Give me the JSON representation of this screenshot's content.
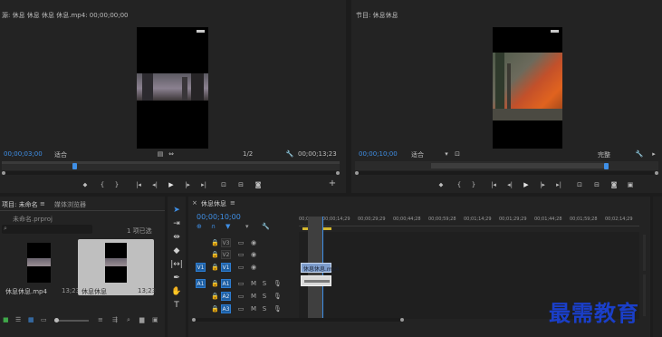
{
  "source_monitor": {
    "title": "源: 休息 休息 休息 休息.mp4: 00;00;00;00",
    "menu_glyph": "≡",
    "timecode": "00;00;03;00",
    "fit_label": "适合",
    "page_fraction": "1/2",
    "duration": "00;00;13;23",
    "plus": "+"
  },
  "program_monitor": {
    "title": "节目: 休息休息",
    "menu_glyph": "≡",
    "timecode": "00;00;10;00",
    "fit_label": "适合",
    "full_label": "完整"
  },
  "transport_icons": [
    "marker-icon",
    "in-point-icon",
    "out-point-icon",
    "go-to-in-icon",
    "step-back-icon",
    "play-icon",
    "step-forward-icon",
    "go-to-out-icon",
    "insert-icon",
    "overwrite-icon",
    "export-frame-icon"
  ],
  "project_panel": {
    "tab_project": "项目: 未命名",
    "tab_media_browser": "媒体浏览器",
    "project_file": "未命名.prproj",
    "item_count": "1 项已选",
    "search_placeholder": "",
    "items": [
      {
        "name": "休息休息.mp4",
        "duration": "13;23"
      },
      {
        "name": "休息休息",
        "duration": "13;23"
      }
    ]
  },
  "timeline": {
    "title": "休息休息",
    "menu_glyph": "≡",
    "timecode": "00;00;10;00",
    "ruler_labels": [
      "00;00",
      "00;00;14;29",
      "00;00;29;29",
      "00;00;44;28",
      "00;00;59;28",
      "00;01;14;29",
      "00;01;29;29",
      "00;01;44;28",
      "00;01;59;28",
      "00;02;14;29"
    ],
    "video_tracks": [
      "V3",
      "V2",
      "V1"
    ],
    "audio_tracks": [
      "A1",
      "A2",
      "A3"
    ],
    "clip_video_label": "休息休息.mp4",
    "clip_audio_label": ""
  },
  "watermark": {
    "text": "最需教育",
    "color": "#1a3fc9"
  }
}
